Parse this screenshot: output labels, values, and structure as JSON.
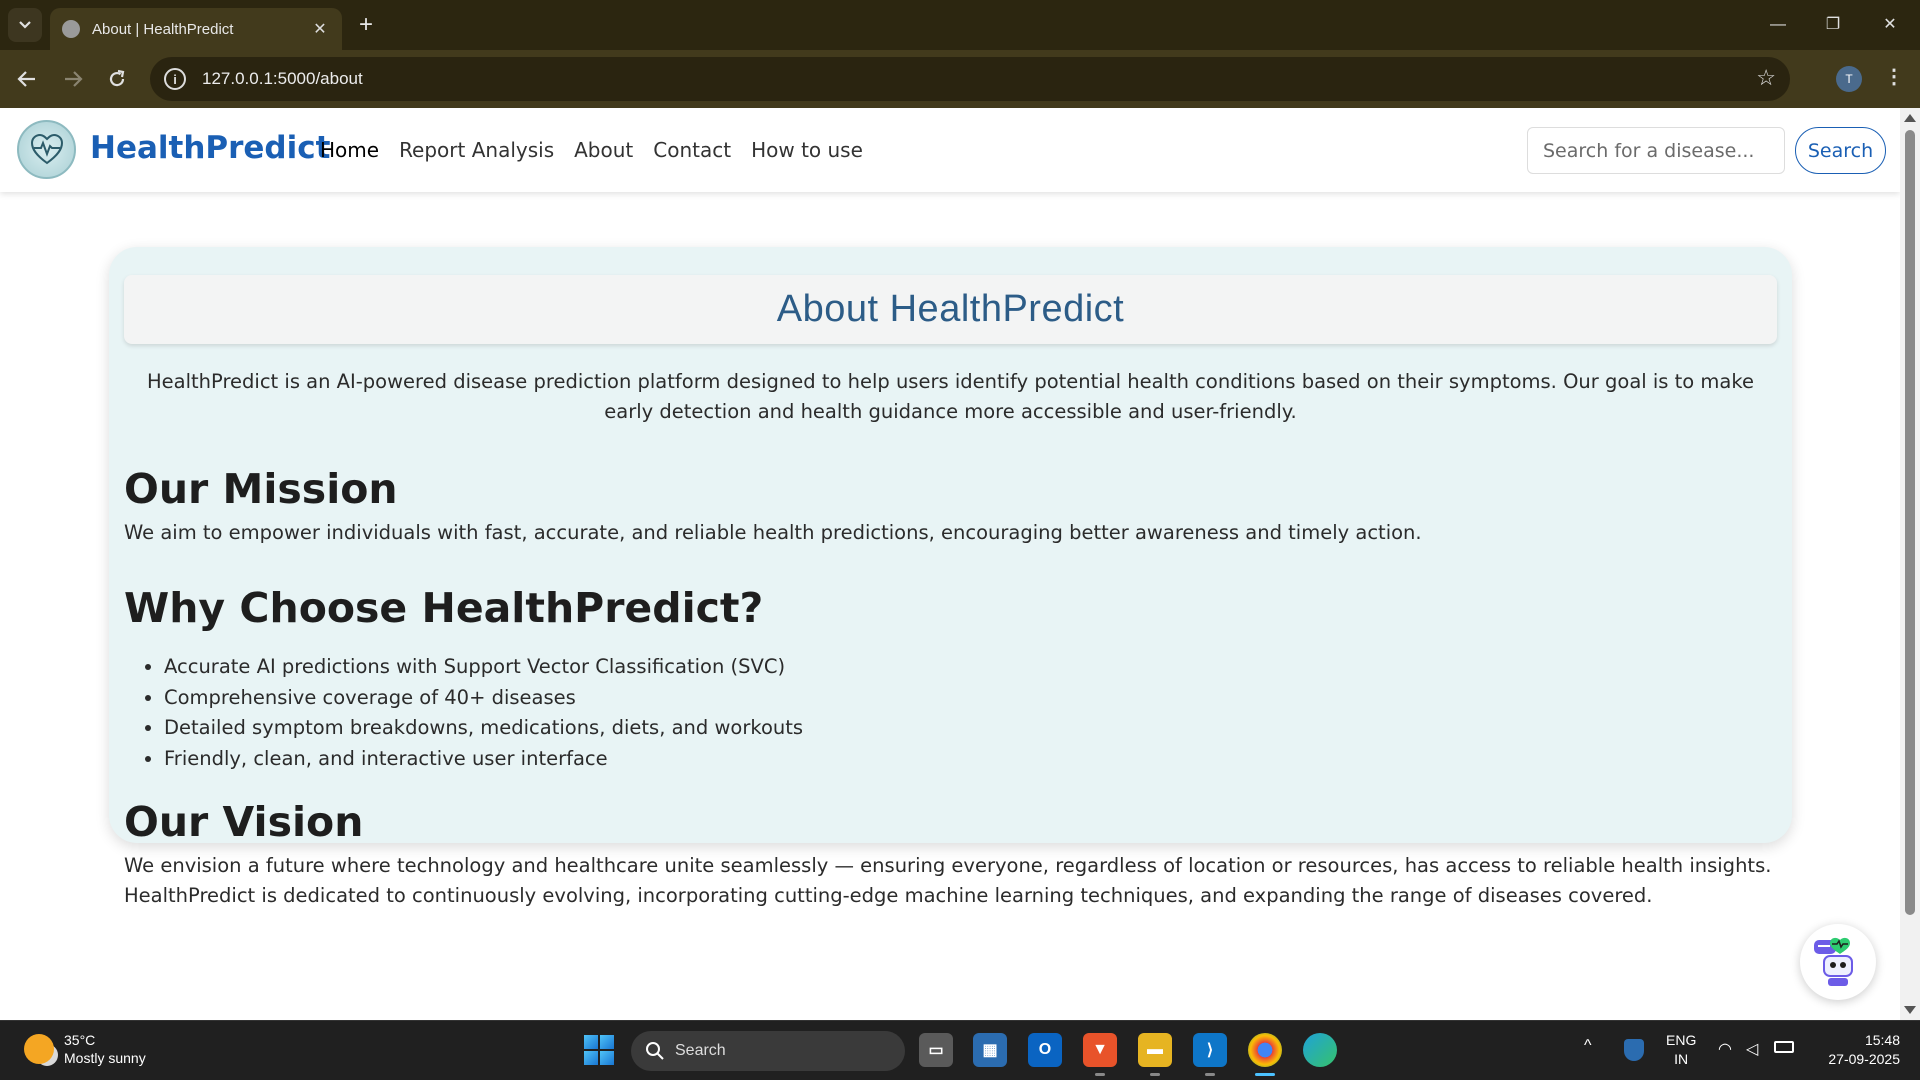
{
  "browser": {
    "tab_title": "About | HealthPredict",
    "url": "127.0.0.1:5000/about",
    "profile_initial": "T"
  },
  "navbar": {
    "brand": "HealthPredict",
    "links": [
      "Home",
      "Report Analysis",
      "About",
      "Contact",
      "How to use"
    ],
    "active_link": "Home",
    "search_placeholder": "Search for a disease...",
    "search_button": "Search"
  },
  "about": {
    "title": "About HealthPredict",
    "intro": "HealthPredict is an AI-powered disease prediction platform designed to help users identify potential health conditions based on their symptoms. Our goal is to make early detection and health guidance more accessible and user-friendly.",
    "mission_heading": "Our Mission",
    "mission_text": "We aim to empower individuals with fast, accurate, and reliable health predictions, encouraging better awareness and timely action.",
    "why_heading": "Why Choose HealthPredict?",
    "features": [
      "Accurate AI predictions with Support Vector Classification (SVC)",
      "Comprehensive coverage of 40+ diseases",
      "Detailed symptom breakdowns, medications, diets, and workouts",
      "Friendly, clean, and interactive user interface"
    ],
    "vision_heading": "Our Vision",
    "vision_text": "We envision a future where technology and healthcare unite seamlessly — ensuring everyone, regardless of location or resources, has access to reliable health insights. HealthPredict is dedicated to continuously evolving, incorporating cutting-edge machine learning techniques, and expanding the range of diseases covered."
  },
  "taskbar": {
    "weather_temp": "35°C",
    "weather_desc": "Mostly sunny",
    "search_label": "Search",
    "language": "ENG",
    "region": "IN",
    "time": "15:48",
    "date": "27-09-2025"
  },
  "colors": {
    "brand_blue": "#1a5fb4",
    "card_background": "#e8f4f5",
    "title_color": "#2c5c87",
    "browser_frame": "#423a1c"
  },
  "icons": [
    "tab-list-icon",
    "globe-favicon-icon",
    "close-icon",
    "plus-icon",
    "minimize-icon",
    "restore-icon",
    "back-arrow-icon",
    "forward-arrow-icon",
    "reload-icon",
    "info-icon",
    "star-icon",
    "more-vert-icon",
    "heartbeat-logo-icon",
    "chatbot-robot-icon",
    "weather-sun-icon",
    "windows-start-icon",
    "search-icon"
  ]
}
